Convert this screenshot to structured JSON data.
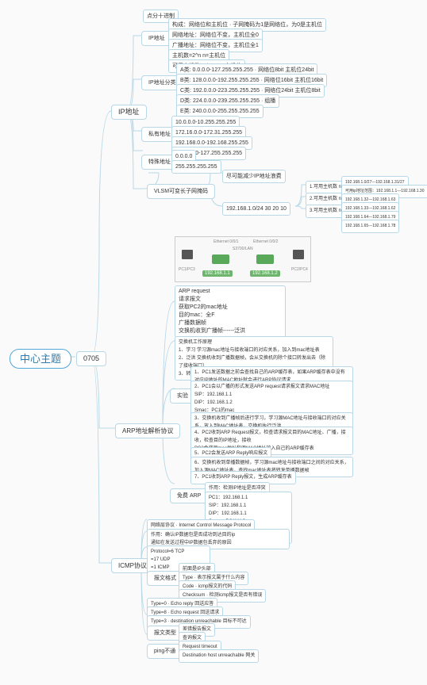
{
  "root": {
    "title": "中心主题",
    "date": "0705"
  },
  "ip": {
    "title": "IP地址",
    "t0": "点分十进制",
    "section_addr": "IP地址",
    "a1": "构成：网络位和主机位 · 子网掩码为1是网络位，为0是主机位",
    "a2": "网络地址：网络位不变，主机位全0",
    "a3": "广播地址：网络位不变，主机位全1",
    "a4": "主机数=2^n  n=主机位",
    "a5": "可用主机数=2^n-2  n=主机位",
    "section_class": "IP地址分类",
    "c1": "A类: 0.0.0.0-127.255.255.255 · 网络位8bit 主机位24bit",
    "c2": "B类: 128.0.0.0-192.255.255.255 · 网络位16bit 主机位16bit",
    "c3": "C类: 192.0.0.0-223.255.255.255 · 网络位24bit 主机位8bit",
    "c4": "D类: 224.0.0.0-239.255.255.255 · 组播",
    "c5": "E类: 240.0.0.0-255.255.255.255",
    "section_priv": "私有地址",
    "p1": "10.0.0.0-10.255.255.255",
    "p2": "172.16.0.0-172.31.255.255",
    "p3": "192.168.0.0-192.168.255.255",
    "p4": "127.0.0.0-127.255.255.255",
    "section_spec": "特殊地址",
    "s1": "0.0.0.0",
    "s2": "255.255.255.255",
    "section_vlsm": "VLSM可变长子网掩码",
    "v0": "尽可能减少IP地址浪费",
    "v1": "192.168.1.0/24   30  20  10",
    "v_r1": "1.可用主机数 n=5 网络位=32-5=27",
    "v_r2": "2.可用主机数 n=5 网络位=32-5=27",
    "v_r3": "3.可用主机数 n=4 网络位=32-4=28",
    "v_o1": "192.168.1.0/27---192.168.1.31/27",
    "v_o2": "可用ip地址范围：192.168.1.1---192.168.1.30",
    "v_o3": "192.168.1.32---192.168.1.63",
    "v_o4": "192.168.1.33---192.168.1.62",
    "v_o5": "192.168.1.64---192.168.1.79",
    "v_o6": "192.168.1.65---192.168.1.78"
  },
  "arp": {
    "title": "ARP地址解析协议",
    "diagram": {
      "ip1": "192.168.1.1",
      "ip2": "192.168.1.2",
      "eth1": "Ethernet 0/0/1",
      "eth2": "Ethernet 0/0/2",
      "host1": "PC1/PC3",
      "host2": "PC2/PC4",
      "sw": "S3700/LAN"
    },
    "req": "ARP request\n请求报文\n获取PC2的mac地址\n目的mac：全F\n广播数据帧\n交换机收到广播帧------泛洪",
    "sw_work": "交换机工作原理\n1、学习 学习源mac地址与接收端口的对应关系，加入到mac地址表\n2、泛洪 交换机收到广播数据帧，会从交换机的除个接口转发出去（除了接收端口）\n3、转发 交换机收到单播数据帧，查找mac地址表进行转发",
    "lab": "实验",
    "l1": "1、PC1发送数据之前会查找自己的ARP缓存表，如果ARP缓存表中没有对应IP地址的MAC地址就会进行ARP协议请求",
    "l2": "2、PC1会以广播的形式发送ARP request请求报文请求MAC地址\n    SIP：192.168.1.1\n    DIP：192.168.1.2\n    Smac：PC1的mac\n    Dmac：FF-FF-FF-FF-FF-FF",
    "l3": "3、交换机收到广播帧后进行学习，学习源MAC地址与接收端口的对应关系，放入到MAC地址表，交换机执行泛洪",
    "l4": "4、PC2收到ARP Request报文，检查请求报文目的MAC地址、广播，接收，检查目的IP地址，接收\n    PC2会将源mac地址和源MAC地址放入自己的ARP缓存表",
    "l5": "5、PC2会发送ARP Reply响应报文",
    "l6": "6、交换机收到单播数据帧，学习源mac地址与接收端口之间的对应关系，加入源MAC地址表，查找mac地址表将转发单播数据帧",
    "l7": "7、PC1收到ARP Reply报文，生成ARP缓存表",
    "free": "免费 ARP",
    "f1": "作用：检测IP地址是否冲突",
    "f2": "PC1：192.168.1.1\nSIP：192.168.1.1\nDIP：192.168.1.1\nSmac：PC1MAC\nDmac：全F\n得到回应---表示地址冲突"
  },
  "icmp": {
    "title": "ICMP协议",
    "n1": "网络层协议 · Internet Control Message Protocol",
    "n2": "作用：确认IP数据包是否成功到达目的ip\n通知在发送过程中IP数据包丢弃的原因",
    "n3": "Protocol=6 TCP\n=17 UDP\n=1  ICMP",
    "fmt": "报文格式",
    "f0": "前面是IP头部",
    "f1": "Type · 表示报文属于什么内容",
    "f2": "Code · icmp报文的代码",
    "f3": "Checksum · 检测icmp报文是否有错误",
    "t0": "Type=0 · Echo reply  回送应答",
    "t8": "Type=8 · Echo request 回送请求",
    "t3": "Type=3 · destination unreachable  目标不可达",
    "mtype": "报文类型",
    "m1": "差错报告报文",
    "m2": "查询报文",
    "ping": "ping不通",
    "p1": "Request timeout",
    "p2": "Destination host unreachable 网关"
  }
}
